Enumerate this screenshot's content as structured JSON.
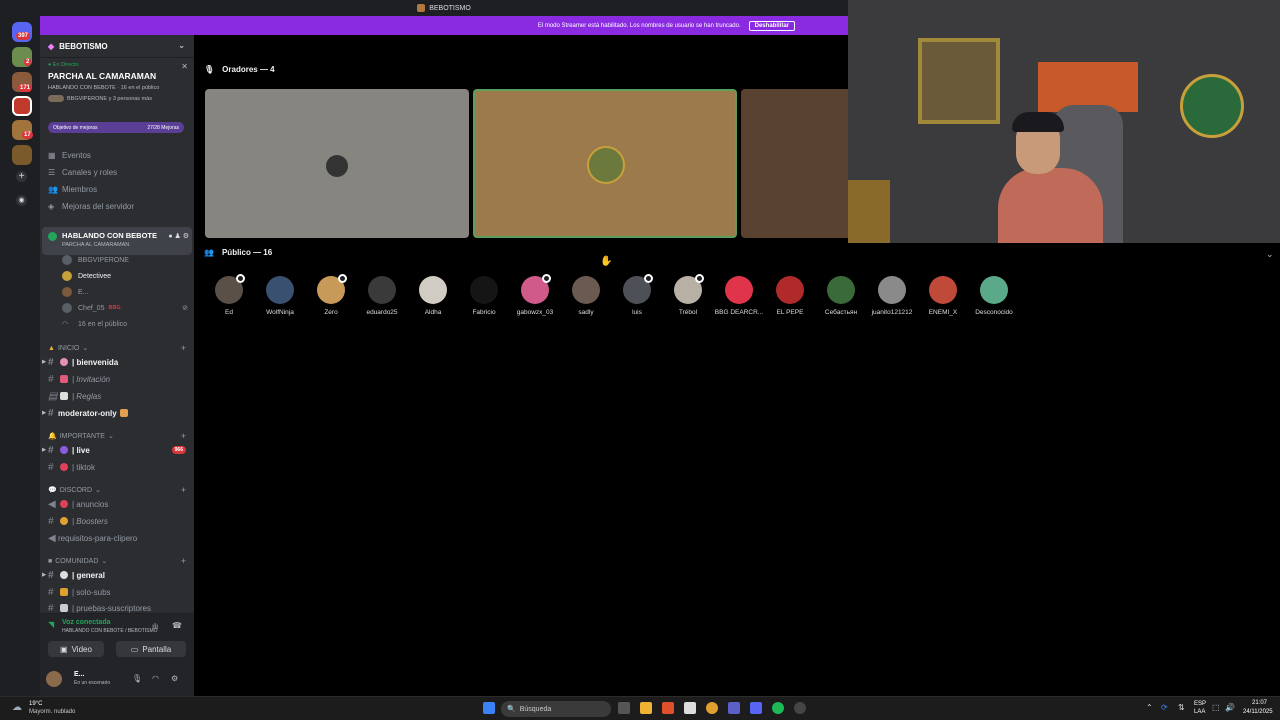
{
  "titlebar": {
    "title": "BEBOTISMO"
  },
  "banner": {
    "text": "El modo Streamer está habilitado. Los nombres de usuario se han truncado.",
    "button": "Deshabilitar"
  },
  "rail": {
    "badges": [
      "397",
      "2",
      "171",
      "17"
    ]
  },
  "server": {
    "name": "BEBOTISMO"
  },
  "live": {
    "status": "En Directo",
    "title": "PARCHA AL CAMARAMAN",
    "subtitle": "HABLANDO CON BEBOTE",
    "listeners": "16 en el público",
    "members": "BBGVIPERONE y 3 personas más",
    "goal_label": "Objetivo de mejoras",
    "goal_value": "27/28 Mejoras"
  },
  "menu": [
    "Eventos",
    "Canales y roles",
    "Miembros",
    "Mejoras del servidor"
  ],
  "stage_channel": {
    "name": "HABLANDO CON BEBOTE",
    "topic": "PARCHA AL CAMARAMAN"
  },
  "stage_users": [
    "BBGVIPERONE",
    "Detectivee",
    "E...",
    "Chef_05",
    "16 en el público"
  ],
  "stage_user_tag": "BBG",
  "categories": {
    "inicio": "INICIO",
    "importante": "IMPORTANTE",
    "discord": "DISCORD",
    "comunidad": "COMUNIDAD"
  },
  "channels": {
    "bienvenida": "| bienvenida",
    "invitacion": "| Invitación",
    "reglas": "| Reglas",
    "moderator": "moderator-only",
    "live": "| live",
    "live_badge": "966",
    "tiktok": "| tiktok",
    "anuncios": "| anuncios",
    "boosters": "| Boosters",
    "requisitos": "requisitos-para-clipero",
    "general": "| general",
    "solosubs": "| solo-subs",
    "pruebas": "| pruebas-suscriptores"
  },
  "voice": {
    "status": "Voz conectada",
    "channel": "HABLANDO CON BEBOTE / BEBOTISMO",
    "video": "Video",
    "screen": "Pantalla"
  },
  "user": {
    "name": "E...",
    "status": "En un escenario"
  },
  "stage": {
    "speakers": "Oradores — 4",
    "audience": "Público — 16"
  },
  "audience": [
    "Ed",
    "WolfNinja",
    "Zero",
    "eduardo25",
    "Aldha",
    "Fabricio",
    "gabowzx_03",
    "sadly",
    "luis",
    "Trébol",
    "BBG DEARCR...",
    "EL PEPE",
    "Себастьян",
    "juanito121212",
    "ENEMI_X",
    "Desconocido"
  ],
  "taskbar": {
    "temp": "19°C",
    "weather": "Mayorm. nublado",
    "search": "Búsqueda",
    "lang": "ESP",
    "lang2": "LAA",
    "time": "21:07",
    "date": "24/11/2025"
  },
  "colors": {
    "accent": "#8a2be2",
    "live": "#23a55a",
    "mention": "#da373c"
  }
}
